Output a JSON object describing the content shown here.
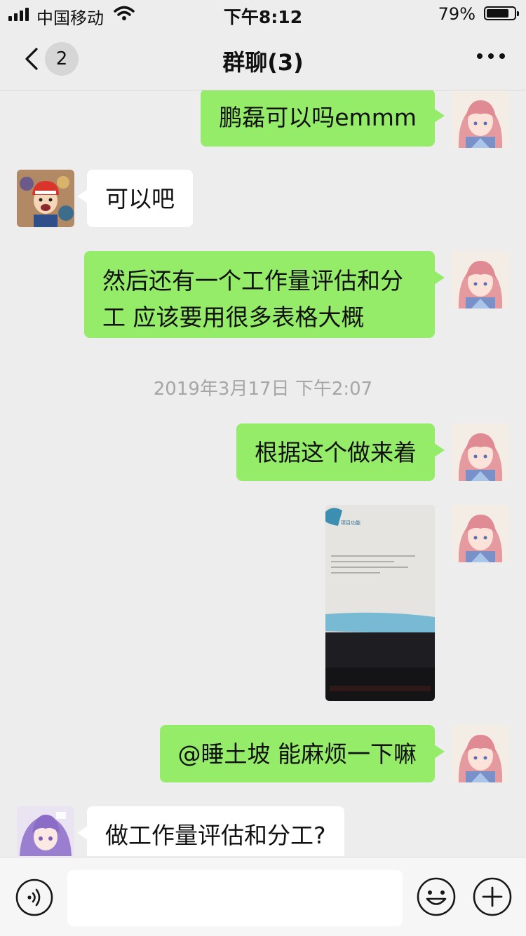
{
  "status_bar": {
    "carrier": "中国移动",
    "time": "下午8:12",
    "battery": "79%"
  },
  "nav": {
    "back_count": "2",
    "title": "群聊(3)"
  },
  "messages": [
    {
      "from": "me",
      "text": "鹏磊可以吗emmm"
    },
    {
      "from": "other",
      "text": "可以吧"
    },
    {
      "from": "me",
      "text": "然后还有一个工作量评估和分工 应该要用很多表格大概"
    },
    {
      "timestamp": "2019年3月17日 下午2:07"
    },
    {
      "from": "me",
      "text": "根据这个做来着"
    },
    {
      "from": "me",
      "type": "image",
      "image_title": "项目功能"
    },
    {
      "from": "me",
      "text": "@睡土坡 能麻烦一下嘛"
    },
    {
      "from": "other",
      "text": "做工作量评估和分工?"
    }
  ],
  "icons": {
    "back": "chevron-left-icon",
    "more": "more-dots-icon",
    "voice": "voice-icon",
    "emoji": "emoji-icon",
    "plus": "plus-icon"
  },
  "colors": {
    "my_bubble": "#95ec69",
    "other_bubble": "#ffffff",
    "background": "#ededed"
  }
}
